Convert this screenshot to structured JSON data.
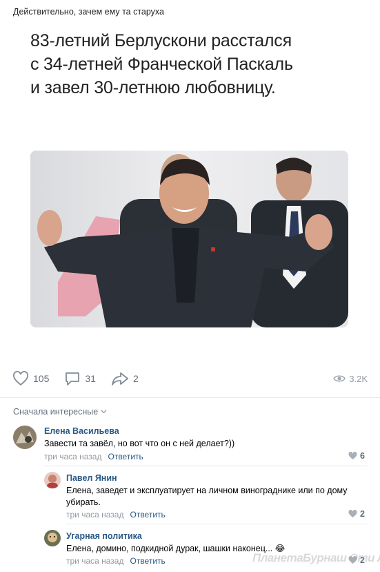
{
  "post": {
    "caption": "Действительно, зачем ему та старуха",
    "headline_lines": [
      "83-летний Берлускони расстался",
      "с 34-летней Франческой Паскаль",
      "и завел 30-летнюю любовницу."
    ]
  },
  "actions": {
    "likes": "105",
    "comments": "31",
    "shares": "2",
    "views": "3.2K"
  },
  "comments_section": {
    "sort_label": "Сначала интересные",
    "items": [
      {
        "author": "Елена Васильева",
        "text": "Завести та завёл, но вот что он с ней делает?))",
        "time": "три часа назад",
        "reply": "Ответить",
        "likes": "6"
      },
      {
        "author": "Павел Янин",
        "text": "Елена, заведет и эксплуатирует на личном винограднике или по дому убирать.",
        "time": "три часа назад",
        "reply": "Ответить",
        "likes": "2"
      },
      {
        "author": "Угарная политика",
        "text": "Елена, домино, подкидной дурак, шашки наконец...",
        "emoji": "😂",
        "time": "три часа назад",
        "reply": "Ответить",
        "likes": "2"
      }
    ]
  },
  "watermark": "ПланетаБурнаш Эти ЛП",
  "colors": {
    "link": "#2a5885",
    "muted": "#939aa3",
    "icon": "#818c99"
  }
}
